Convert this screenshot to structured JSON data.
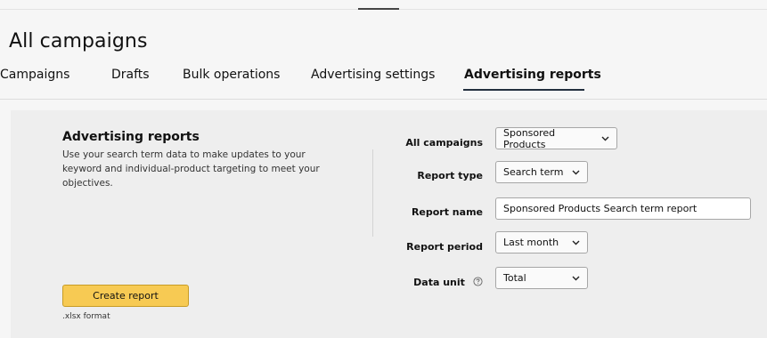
{
  "page_title": "All campaigns",
  "tabs": [
    {
      "label": "Campaigns"
    },
    {
      "label": "Drafts"
    },
    {
      "label": "Bulk operations"
    },
    {
      "label": "Advertising settings"
    },
    {
      "label": "Advertising reports",
      "active": true
    }
  ],
  "panel": {
    "title": "Advertising reports",
    "description": "Use your search term data to make updates to your keyword and individual-product targeting to meet your objectives.",
    "create_button": "Create report",
    "format_note": ".xlsx format"
  },
  "form": {
    "campaigns_label": "All campaigns",
    "campaigns_value": "Sponsored Products",
    "report_type_label": "Report type",
    "report_type_value": "Search term",
    "report_name_label": "Report name",
    "report_name_value": "Sponsored Products Search term report",
    "report_period_label": "Report period",
    "report_period_value": "Last month",
    "data_unit_label": "Data unit",
    "data_unit_value": "Total"
  },
  "colors": {
    "accent_button": "#f7ca53",
    "active_tab_underline": "#232f3e"
  }
}
